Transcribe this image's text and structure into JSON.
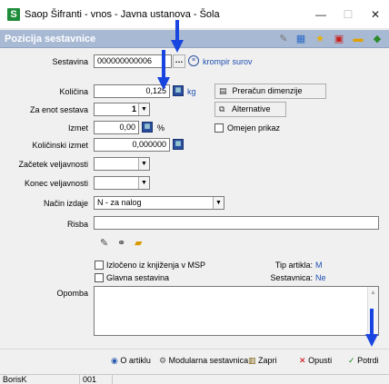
{
  "window": {
    "title": "Saop Šifranti - vnos - Javna ustanova - Šola",
    "app_icon_letter": "S",
    "minimize": "—",
    "maximize": "☐",
    "close": "✕"
  },
  "section": {
    "title": "Pozicija sestavnice"
  },
  "form": {
    "sestavina_label": "Sestavina",
    "sestavina_value": "000000000006",
    "sestavina_desc": "krompir surov",
    "kolicina_label": "Količina",
    "kolicina_value": "0,125",
    "kolicina_unit": "kg",
    "za_enot_label": "Za enot sestava",
    "za_enot_value": "1",
    "izmet_label": "Izmet",
    "izmet_value": "0,00",
    "izmet_unit": "%",
    "kol_izmet_label": "Količinski izmet",
    "kol_izmet_value": "0,000000",
    "zacetek_label": "Začetek veljavnosti",
    "konec_label": "Konec veljavnosti",
    "nacin_label": "Način izdaje",
    "nacin_value": "N - za nalog",
    "risba_label": "Risba",
    "opomba_label": "Opomba",
    "preracun_btn": "Preračun dimenzije",
    "alternative_btn": "Alternative",
    "omejen_label": "Omejen prikaz",
    "izloceno_label": "Izločeno iz knjiženja v MSP",
    "glavna_label": "Glavna sestavina",
    "tip_artikla_label": "Tip artikla:",
    "tip_artikla_value": "M",
    "sestavnica_label": "Sestavnica:",
    "sestavnica_value": "Ne"
  },
  "bottom": {
    "o_artiklu": "O artiklu",
    "modularna": "Modularna sestavnica",
    "zapri": "Zapri",
    "opusti": "Opusti",
    "potrdi": "Potrdi"
  },
  "status": {
    "user": "BorisK",
    "code": "001"
  },
  "colors": {
    "header_bg": "#a8b9d4",
    "accent_blue": "#1f4fb0",
    "annotation_arrow": "#1844e0"
  }
}
